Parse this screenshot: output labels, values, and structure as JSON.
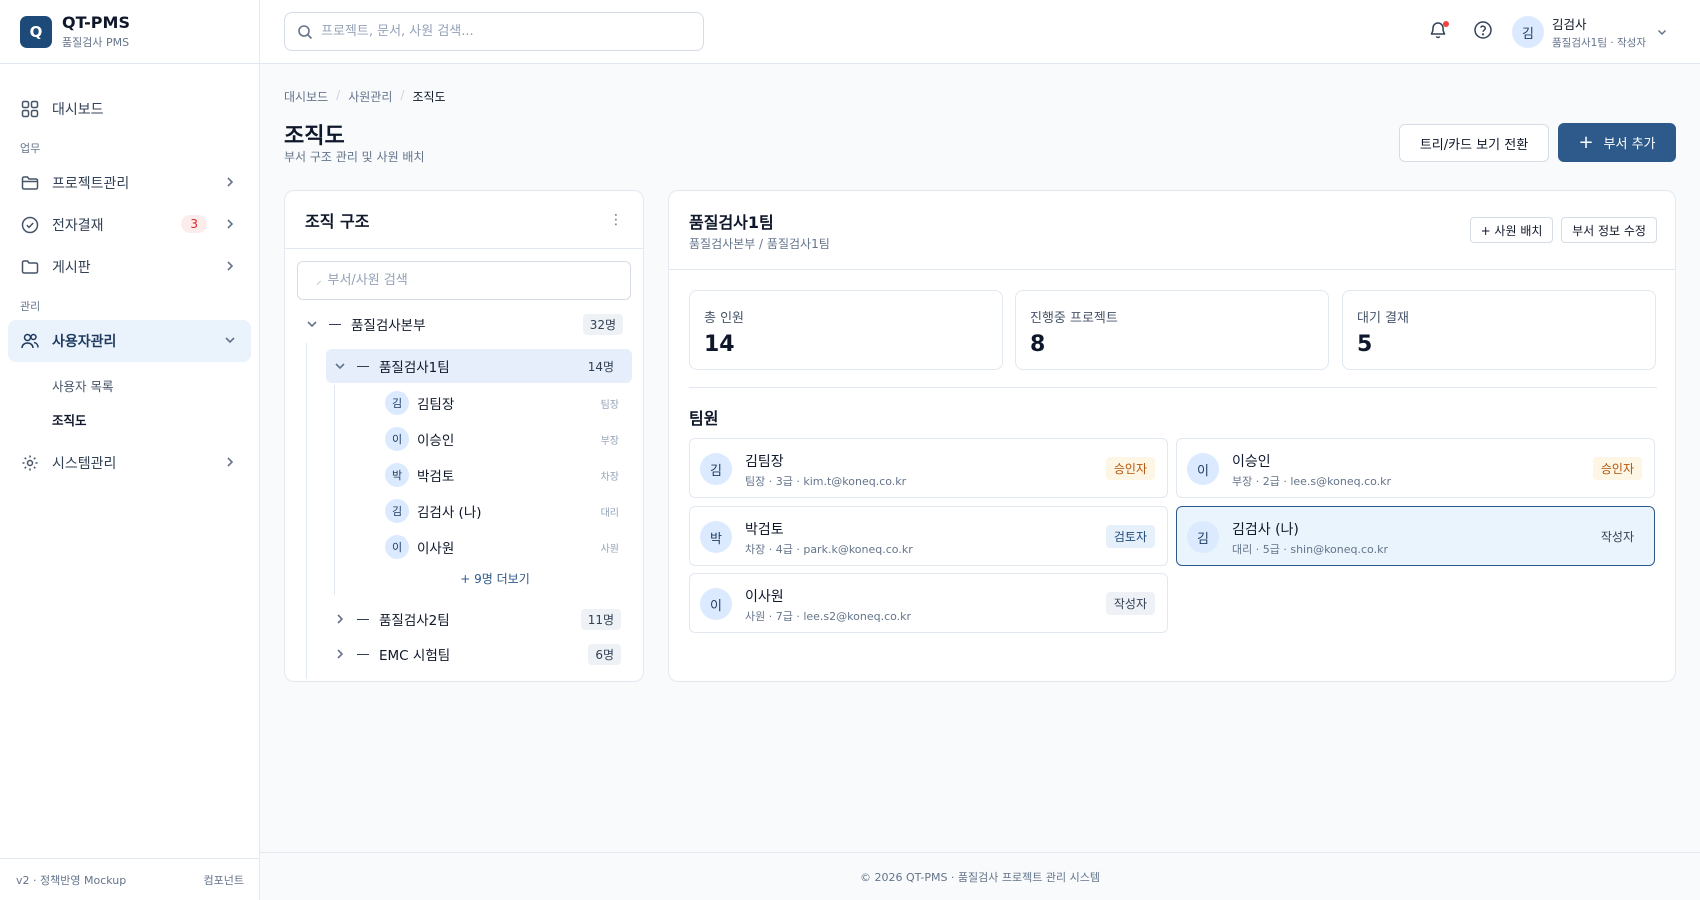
{
  "brand": {
    "logo": "Q",
    "name": "QT-PMS",
    "sub": "품질검사 PMS"
  },
  "sidebar": {
    "dashboard": "대시보드",
    "section_work": "업무",
    "projects": "프로젝트관리",
    "approval": "전자결재",
    "approval_badge": "3",
    "board": "게시판",
    "section_admin": "관리",
    "users": "사용자관리",
    "user_list": "사용자 목록",
    "org_chart": "조직도",
    "system": "시스템관리",
    "footer_left": "v2 · 정책반영 Mockup",
    "footer_right": "컴포넌트"
  },
  "topbar": {
    "search_placeholder": "프로젝트, 문서, 사원 검색...",
    "user_avatar": "김",
    "user_name": "김검사",
    "user_sub": "품질검사1팀 · 작성자"
  },
  "breadcrumb": [
    "대시보드",
    "사원관리",
    "조직도"
  ],
  "page": {
    "title": "조직도",
    "subtitle": "부서 구조 관리 및 사원 배치",
    "toggle_view": "트리/카드 보기 전환",
    "add_dept": "부서 추가"
  },
  "org": {
    "title": "조직 구조",
    "search_placeholder": "부서/사원 검색",
    "root": {
      "name": "품질검사본부",
      "count": "32명"
    },
    "team1": {
      "name": "품질검사1팀",
      "count": "14명"
    },
    "members": [
      {
        "avatar": "김",
        "name": "김팀장",
        "role": "팀장"
      },
      {
        "avatar": "이",
        "name": "이승인",
        "role": "부장"
      },
      {
        "avatar": "박",
        "name": "박검토",
        "role": "차장"
      },
      {
        "avatar": "김",
        "name": "김검사 (나)",
        "role": "대리"
      },
      {
        "avatar": "이",
        "name": "이사원",
        "role": "사원"
      }
    ],
    "more": "+ 9명 더보기",
    "team2": {
      "name": "품질검사2팀",
      "count": "11명"
    },
    "team3": {
      "name": "EMC 시험팀",
      "count": "6명"
    }
  },
  "detail": {
    "title": "품질검사1팀",
    "path": "품질검사본부 / 품질검사1팀",
    "assign_btn": "+ 사원 배치",
    "edit_btn": "부서 정보 수정",
    "stats": [
      {
        "label": "총 인원",
        "value": "14"
      },
      {
        "label": "진행중 프로젝트",
        "value": "8"
      },
      {
        "label": "대기 결재",
        "value": "5"
      }
    ],
    "members_title": "팀원",
    "members": [
      {
        "avatar": "김",
        "name": "김팀장",
        "meta": "팀장 · 3급 · kim.t@koneq.co.kr",
        "role": "승인자"
      },
      {
        "avatar": "이",
        "name": "이승인",
        "meta": "부장 · 2급 · lee.s@koneq.co.kr",
        "role": "승인자"
      },
      {
        "avatar": "박",
        "name": "박검토",
        "meta": "차장 · 4급 · park.k@koneq.co.kr",
        "role": "검토자"
      },
      {
        "avatar": "김",
        "name": "김검사 (나)",
        "meta": "대리 · 5급 · shin@koneq.co.kr",
        "role": "작성자"
      },
      {
        "avatar": "이",
        "name": "이사원",
        "meta": "사원 · 7급 · lee.s2@koneq.co.kr",
        "role": "작성자"
      }
    ]
  },
  "footer": "© 2026 QT-PMS · 품질검사 프로젝트 관리 시스템",
  "colors": {
    "primary": "#2d5a8a",
    "active_bg": "#eaf2fc",
    "approver": "#b45309",
    "alert": "#ef4444"
  }
}
